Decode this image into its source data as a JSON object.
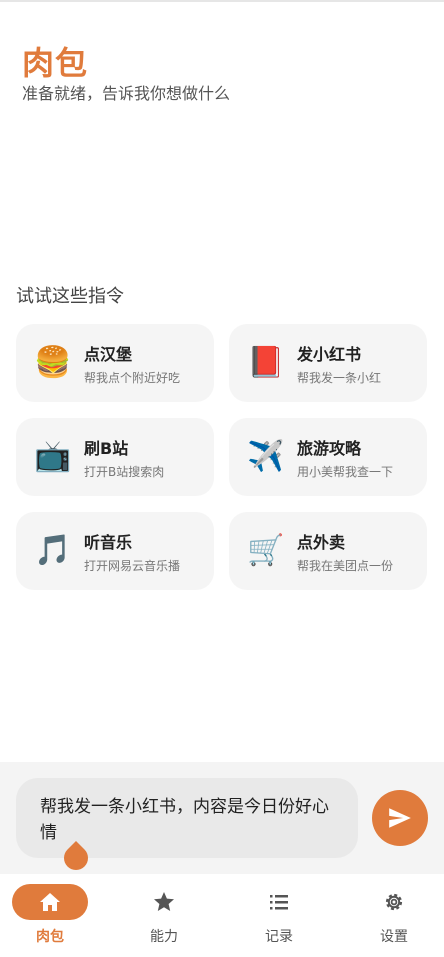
{
  "header": {
    "title": "肉包",
    "subtitle": "准备就绪，告诉我你想做什么"
  },
  "suggestions": {
    "section_title": "试试这些指令",
    "cards": [
      {
        "emoji": "🍔",
        "title": "点汉堡",
        "desc": "帮我点个附近好吃"
      },
      {
        "emoji": "📕",
        "title": "发小红书",
        "desc": "帮我发一条小红"
      },
      {
        "emoji": "📺",
        "title": "刷B站",
        "desc": "打开B站搜索肉"
      },
      {
        "emoji": "✈️",
        "title": "旅游攻略",
        "desc": "用小美帮我查一下"
      },
      {
        "emoji": "🎵",
        "title": "听音乐",
        "desc": "打开网易云音乐播"
      },
      {
        "emoji": "🛒",
        "title": "点外卖",
        "desc": "帮我在美团点一份"
      }
    ]
  },
  "input": {
    "value": "帮我发一条小红书，内容是今日份好心情"
  },
  "nav": {
    "items": [
      {
        "label": "肉包",
        "icon": "home-icon",
        "active": true
      },
      {
        "label": "能力",
        "icon": "star-icon"
      },
      {
        "label": "记录",
        "icon": "list-icon"
      },
      {
        "label": "设置",
        "icon": "gear-icon"
      }
    ]
  },
  "colors": {
    "accent": "#e07b3c",
    "card_bg": "#f5f5f5",
    "input_bg": "#e9e9e9"
  }
}
